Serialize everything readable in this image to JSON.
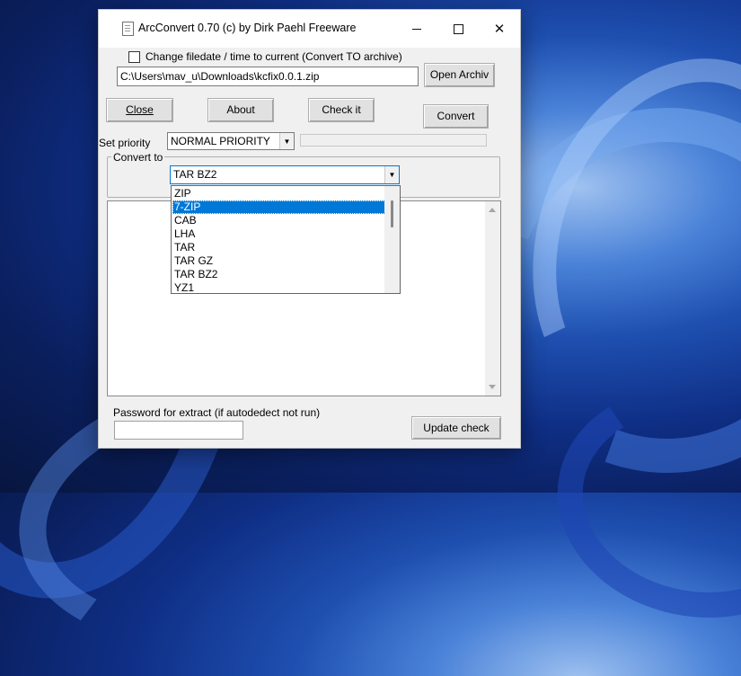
{
  "window": {
    "title": "ArcConvert 0.70 (c) by Dirk Paehl Freeware"
  },
  "options": {
    "change_filedate_label": "Change filedate / time to current (Convert TO archive)",
    "change_filedate_checked": false
  },
  "file": {
    "path": "C:\\Users\\mav_u\\Downloads\\kcfix0.0.1.zip",
    "open_button": "Open Archiv"
  },
  "buttons": {
    "close": "Close",
    "about": "About",
    "check": "Check it",
    "convert": "Convert",
    "update_check": "Update check"
  },
  "priority": {
    "label": "Set priority",
    "selected": "NORMAL PRIORITY"
  },
  "progress": {
    "value": 0
  },
  "convert_to": {
    "label": "Convert to",
    "selected": "TAR BZ2",
    "options": [
      "ZIP",
      "7-ZIP",
      "CAB",
      "LHA",
      "TAR",
      "TAR GZ",
      "TAR BZ2",
      "YZ1"
    ],
    "highlighted": "7-ZIP"
  },
  "password": {
    "label": "Password for extract (if autodedect not run)",
    "value": ""
  },
  "icons": {
    "app": "document-icon",
    "minimize": "minimize-icon",
    "maximize": "maximize-icon",
    "close": "close-icon",
    "dropdown": "chevron-down-icon",
    "scroll_up": "scroll-up-arrow-icon",
    "scroll_down": "scroll-down-arrow-icon"
  },
  "colors": {
    "selection": "#0078d7",
    "window_bg": "#f0f0f0"
  }
}
